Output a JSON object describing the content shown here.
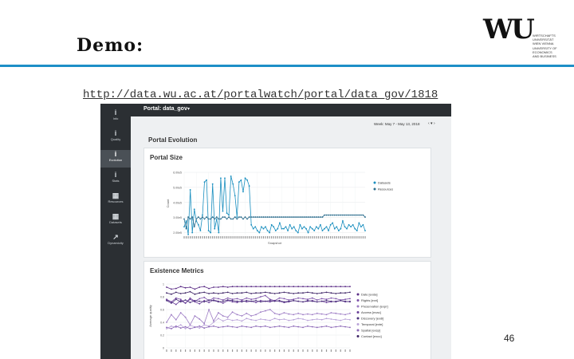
{
  "slide": {
    "title": "Demo:",
    "url": "http://data.wu.ac.at/portalwatch/portal/data_gov/1818",
    "page_number": "46",
    "rule_color": "#1e8fc7",
    "logo_mark": "WU",
    "logo_lines": [
      "WIRTSCHAFTS",
      "UNIVERSITÄT",
      "WIEN VIENNA",
      "UNIVERSITY OF",
      "ECONOMICS",
      "AND BUSINESS"
    ]
  },
  "app": {
    "portal_title": "Portal: data_gov",
    "week_label": "Week: May 7 - May 13, 2018",
    "week_nav": "‹ ▾ ›",
    "section_title": "Portal Evolution",
    "sidebar": [
      {
        "label": "Info",
        "icon": "i"
      },
      {
        "label": "Quality",
        "icon": "i"
      },
      {
        "label": "Evolution",
        "icon": "i",
        "active": true
      },
      {
        "label": "Stats",
        "icon": "i"
      },
      {
        "label": "Resources",
        "icon": "▦"
      },
      {
        "label": "Datasets",
        "icon": "▦"
      },
      {
        "label": "Dynamicity",
        "icon": "↗"
      }
    ]
  },
  "chart_data": [
    {
      "type": "line",
      "title": "Portal Size",
      "xlabel": "Snapshot",
      "ylabel": "Count",
      "ylim": [
        1.9,
        5.1
      ],
      "yticks": [
        "2.00e5",
        "3.00e5",
        "4.00e5",
        "5.00e5",
        "6.00e5"
      ],
      "grid": true,
      "legend_position": "right",
      "series": [
        {
          "name": "Datasets",
          "color": "#1a8fbf",
          "values": [
            2.3,
            2.6,
            1.9,
            4.2,
            2.0,
            3.2,
            2.6,
            2.4,
            2.1,
            2.9,
            4.6,
            4.7,
            2.1,
            2.0,
            4.5,
            2.2,
            2.7,
            2.0,
            4.8,
            3.1,
            4.8,
            3.0,
            2.9,
            4.9,
            4.5,
            3.9,
            2.8,
            4.6,
            4.7,
            4.1,
            4.8,
            4.7,
            4.4,
            2.4,
            2.2,
            2.3,
            2.1,
            2.0,
            2.3,
            2.2,
            2.3,
            2.1,
            2.0,
            2.4,
            2.3,
            2.1,
            2.2,
            2.5,
            2.2,
            2.2,
            2.3,
            2.1,
            2.4,
            2.2,
            2.3,
            2.1,
            2.0,
            2.4,
            2.2,
            2.3,
            2.2,
            2.0,
            2.3,
            2.2,
            2.1,
            2.3,
            2.2,
            2.4,
            2.1,
            2.2,
            2.3,
            2.1,
            2.4,
            2.5,
            2.2,
            2.3,
            2.1,
            2.2,
            2.6,
            2.3,
            2.2,
            2.4,
            2.3,
            2.4,
            2.2,
            2.1,
            2.5,
            2.3,
            2.4,
            2.1
          ]
        },
        {
          "name": "Resources",
          "color": "#2d6e8e",
          "values": [
            2.7,
            2.2,
            2.8,
            2.7,
            2.8,
            2.3,
            2.7,
            2.8,
            2.7,
            2.8,
            2.7,
            2.8,
            2.7,
            2.7,
            2.8,
            2.7,
            2.8,
            2.7,
            2.7,
            2.8,
            2.8,
            2.7,
            2.8,
            2.7,
            2.7,
            2.8,
            2.7,
            2.8,
            2.8,
            2.7,
            2.8,
            2.7,
            2.8,
            2.8,
            2.8,
            2.8,
            2.8,
            2.8,
            2.8,
            2.8,
            2.8,
            2.8,
            2.8,
            2.8,
            2.8,
            2.8,
            2.8,
            2.8,
            2.8,
            2.8,
            2.8,
            2.8,
            2.8,
            2.8,
            2.8,
            2.8,
            2.8,
            2.8,
            2.8,
            2.8,
            2.8,
            2.8,
            2.8,
            2.8,
            2.8,
            2.8,
            2.8,
            2.8,
            2.8,
            2.9,
            2.9,
            2.9,
            2.9,
            2.9,
            2.9,
            2.9,
            2.9,
            2.9,
            2.9,
            2.9,
            2.9,
            2.9,
            2.9,
            2.9,
            2.9,
            2.9,
            2.9,
            2.9,
            2.9,
            2.8
          ]
        }
      ]
    },
    {
      "type": "line",
      "title": "Existence Metrics",
      "xlabel": "",
      "ylabel": "Average quality",
      "ylim": [
        0,
        1
      ],
      "yticks": [
        "0",
        "0.2",
        "0.4",
        "0.6",
        "0.8",
        "1"
      ],
      "grid": true,
      "legend_position": "right",
      "series": [
        {
          "name": "Date [exda]",
          "color": "#5b2d86",
          "values": [
            0.95,
            0.92,
            0.93,
            0.96,
            0.94,
            0.95,
            0.92,
            0.95,
            0.96,
            0.93,
            0.95,
            0.95,
            0.96,
            0.95,
            0.96,
            0.96,
            0.96,
            0.96,
            0.96,
            0.96,
            0.96,
            0.96,
            0.96,
            0.96,
            0.96,
            0.96,
            0.96,
            0.96,
            0.96,
            0.96,
            0.96,
            0.96,
            0.96,
            0.96,
            0.96,
            0.96,
            0.96,
            0.96,
            0.96,
            0.96
          ]
        },
        {
          "name": "Rights [exri]",
          "color": "#7b4fa8",
          "values": [
            0.75,
            0.72,
            0.78,
            0.76,
            0.7,
            0.78,
            0.73,
            0.77,
            0.79,
            0.74,
            0.78,
            0.77,
            0.75,
            0.78,
            0.76,
            0.77,
            0.75,
            0.78,
            0.76,
            0.77,
            0.8,
            0.82,
            0.76,
            0.74,
            0.78,
            0.77,
            0.75,
            0.76,
            0.78,
            0.77,
            0.76,
            0.78,
            0.75,
            0.77,
            0.76,
            0.78,
            0.77,
            0.75,
            0.76,
            0.77
          ]
        },
        {
          "name": "Preservation [expr]",
          "color": "#9d7cc4",
          "values": [
            0.4,
            0.52,
            0.44,
            0.55,
            0.48,
            0.36,
            0.5,
            0.45,
            0.38,
            0.6,
            0.42,
            0.55,
            0.5,
            0.48,
            0.56,
            0.52,
            0.5,
            0.54,
            0.5,
            0.52,
            0.56,
            0.58,
            0.6,
            0.54,
            0.52,
            0.55,
            0.53,
            0.52,
            0.54,
            0.52,
            0.53,
            0.52,
            0.54,
            0.53,
            0.52,
            0.55,
            0.54,
            0.53,
            0.52,
            0.54
          ]
        },
        {
          "name": "Access [exac]",
          "color": "#6a3f99",
          "values": [
            0.76,
            0.72,
            0.68,
            0.74,
            0.7,
            0.76,
            0.72,
            0.69,
            0.74,
            0.71,
            0.75,
            0.73,
            0.7,
            0.74,
            0.72,
            0.71,
            0.74,
            0.72,
            0.73,
            0.71,
            0.74,
            0.73,
            0.72,
            0.74,
            0.73,
            0.71,
            0.72,
            0.74,
            0.73,
            0.72,
            0.73,
            0.74,
            0.72,
            0.73,
            0.71,
            0.72,
            0.73,
            0.74,
            0.72,
            0.73
          ]
        },
        {
          "name": "Discovery [exdi]",
          "color": "#4a2f7a",
          "values": [
            0.74,
            0.7,
            0.76,
            0.72,
            0.75,
            0.71,
            0.74,
            0.73,
            0.72,
            0.75,
            0.74,
            0.72,
            0.73,
            0.75,
            0.74,
            0.73,
            0.72,
            0.74,
            0.73,
            0.74,
            0.72,
            0.73,
            0.74,
            0.73,
            0.74,
            0.72,
            0.73,
            0.74,
            0.73,
            0.72,
            0.74,
            0.73,
            0.72,
            0.73,
            0.74,
            0.73,
            0.72,
            0.74,
            0.73,
            0.72
          ]
        },
        {
          "name": "Temporal [exte]",
          "color": "#b9a3d8",
          "values": [
            0.3,
            0.34,
            0.32,
            0.36,
            0.3,
            0.35,
            0.33,
            0.31,
            0.36,
            0.34,
            0.4,
            0.46,
            0.42,
            0.45,
            0.43,
            0.44,
            0.42,
            0.46,
            0.44,
            0.43,
            0.45,
            0.44,
            0.43,
            0.46,
            0.44,
            0.45,
            0.43,
            0.44,
            0.46,
            0.45,
            0.43,
            0.44,
            0.45,
            0.44,
            0.46,
            0.45,
            0.44,
            0.43,
            0.45,
            0.44
          ]
        },
        {
          "name": "Spatial [exsp]",
          "color": "#8a66b6",
          "values": [
            0.32,
            0.3,
            0.34,
            0.31,
            0.33,
            0.3,
            0.32,
            0.34,
            0.31,
            0.33,
            0.34,
            0.32,
            0.33,
            0.34,
            0.33,
            0.32,
            0.34,
            0.33,
            0.32,
            0.34,
            0.33,
            0.34,
            0.32,
            0.33,
            0.34,
            0.33,
            0.32,
            0.34,
            0.33,
            0.32,
            0.34,
            0.33,
            0.32,
            0.33,
            0.34,
            0.32,
            0.33,
            0.34,
            0.33,
            0.32
          ]
        },
        {
          "name": "Contact [exco]",
          "color": "#3d2466",
          "values": [
            0.86,
            0.84,
            0.87,
            0.85,
            0.86,
            0.88,
            0.84,
            0.86,
            0.87,
            0.85,
            0.86,
            0.85,
            0.86,
            0.87,
            0.85,
            0.86,
            0.86,
            0.87,
            0.85,
            0.86,
            0.86,
            0.87,
            0.86,
            0.85,
            0.86,
            0.87,
            0.86,
            0.85,
            0.86,
            0.86,
            0.87,
            0.86,
            0.85,
            0.86,
            0.87,
            0.86,
            0.85,
            0.86,
            0.86,
            0.87
          ]
        }
      ]
    }
  ]
}
